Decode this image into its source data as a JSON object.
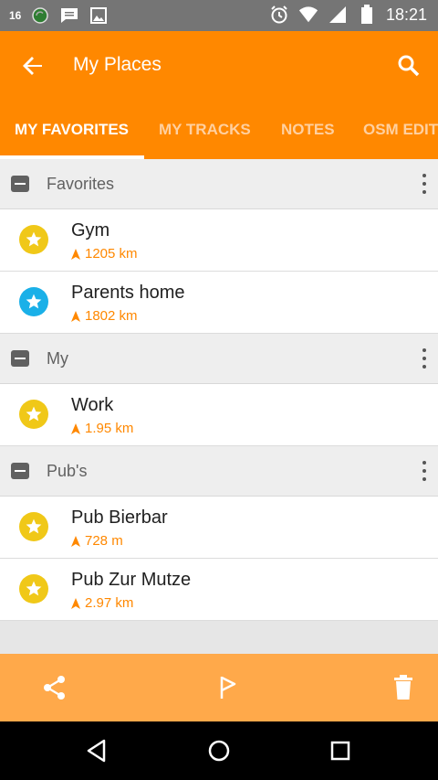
{
  "status_bar": {
    "left_icons": [
      "notification-number-icon",
      "sync-icon",
      "message-icon",
      "image-icon"
    ],
    "notification_number": "16",
    "right_icons": [
      "alarm-icon",
      "wifi-icon",
      "signal-icon",
      "battery-icon"
    ],
    "time": "18:21"
  },
  "toolbar": {
    "title": "My Places",
    "back_icon": "arrow-back-icon",
    "search_icon": "search-icon"
  },
  "tabs": [
    {
      "label": "MY FAVORITES",
      "active": true
    },
    {
      "label": "MY TRACKS",
      "active": false
    },
    {
      "label": "NOTES",
      "active": false
    },
    {
      "label": "OSM EDITS",
      "active": false
    }
  ],
  "groups": [
    {
      "name": "Favorites",
      "items": [
        {
          "name": "Gym",
          "distance": "1205 km",
          "color": "#f0c818"
        },
        {
          "name": "Parents home",
          "distance": "1802 km",
          "color": "#1ab0e8"
        }
      ]
    },
    {
      "name": "My",
      "items": [
        {
          "name": "Work",
          "distance": "1.95 km",
          "color": "#f0c818"
        }
      ]
    },
    {
      "name": "Pub's",
      "items": [
        {
          "name": "Pub Bierbar",
          "distance": "728 m",
          "color": "#f0c818"
        },
        {
          "name": "Pub Zur Mutze",
          "distance": "2.97 km",
          "color": "#f0c818"
        }
      ]
    }
  ],
  "bottom_bar": {
    "icons": [
      "share-icon",
      "flag-icon",
      "delete-icon"
    ]
  },
  "colors": {
    "accent": "#ff8800",
    "bottom_bar": "#ffa94a",
    "status_bar": "#757575"
  }
}
